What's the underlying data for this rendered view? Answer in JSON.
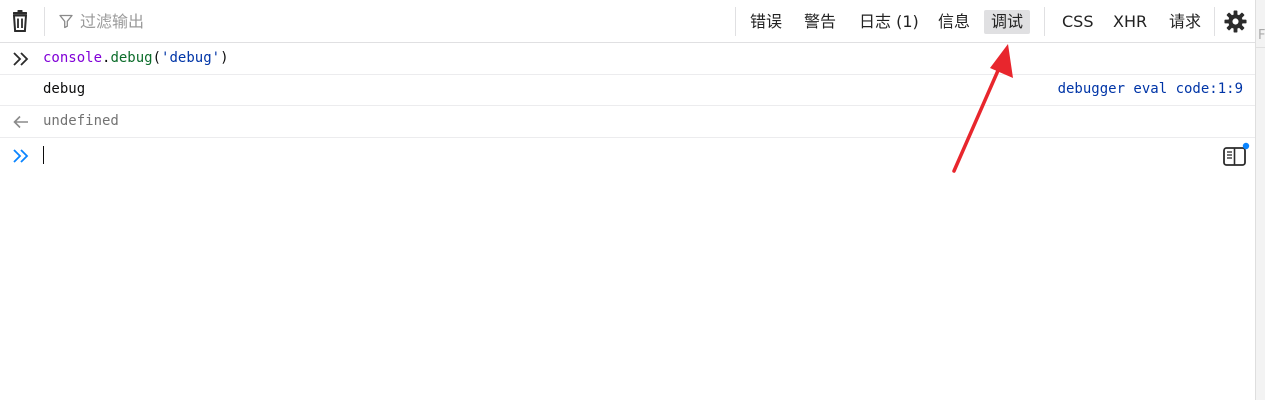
{
  "toolbar": {
    "clear_icon": "trash-icon",
    "filter_icon": "funnel-icon",
    "filter_placeholder": "过滤输出",
    "log_levels": [
      "错误",
      "警告",
      "日志 (1)",
      "信息",
      "调试"
    ],
    "active_level": "调试",
    "request_types": [
      "CSS",
      "XHR",
      "请求"
    ],
    "settings_icon": "gear-icon"
  },
  "messages": {
    "command": {
      "icon": "double-chevron-right-icon",
      "obj": "console",
      "dot": ".",
      "method": "debug",
      "open": "(",
      "arg": "'debug'",
      "close": ")"
    },
    "debug_message": {
      "text": "debug",
      "source": "debugger eval code:1:9"
    },
    "result": {
      "icon": "arrow-left-icon",
      "text": "undefined"
    }
  },
  "input": {
    "prompt_icon": "double-chevron-right-icon",
    "value": "",
    "editor_toggle_icon": "split-editor-icon"
  },
  "colors": {
    "annotation_arrow": "#e8262d",
    "accent_blue": "#0a84ff",
    "active_tab_bg": "#e0e0e2"
  }
}
